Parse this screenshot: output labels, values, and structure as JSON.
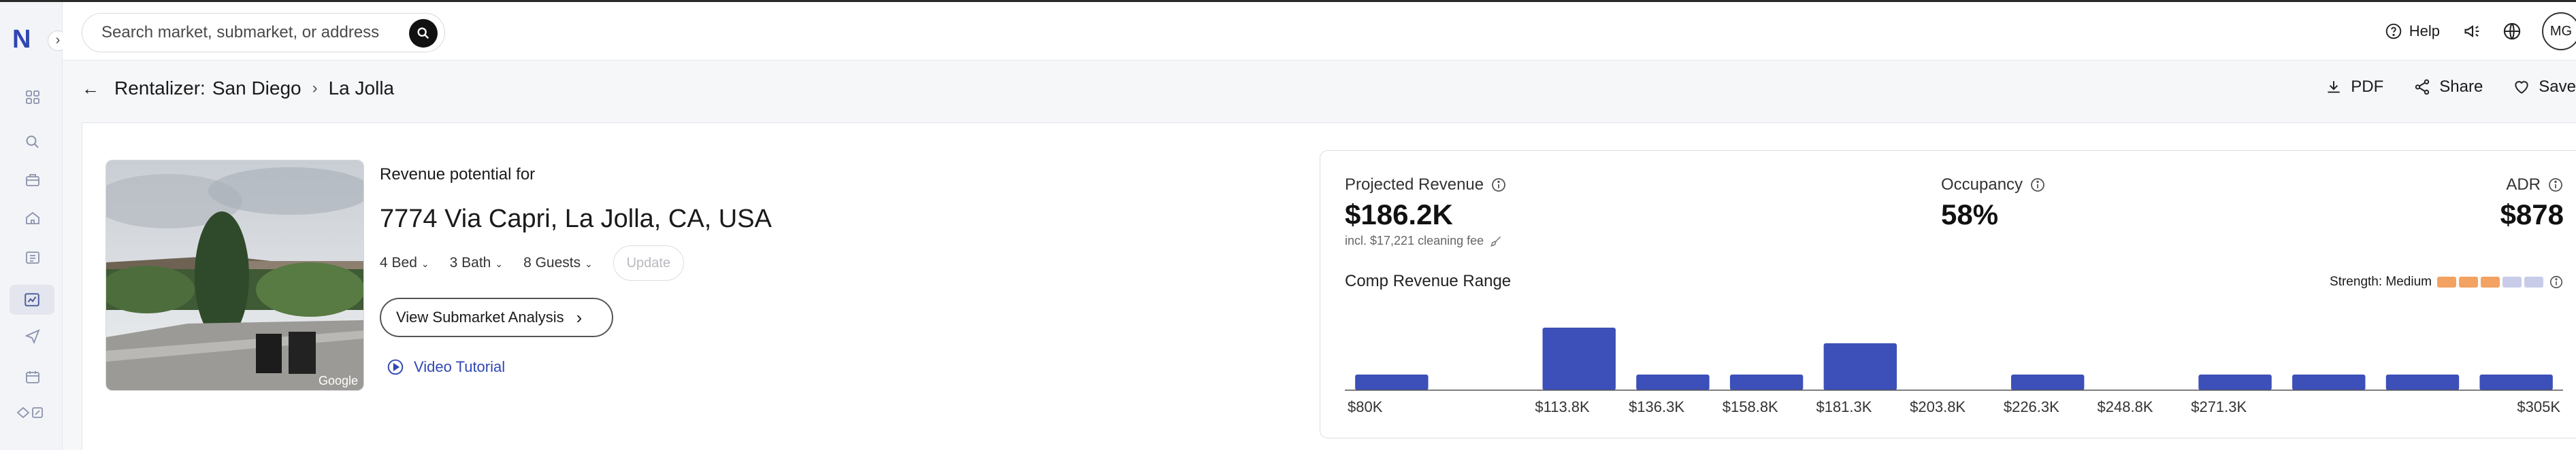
{
  "sidebar": {
    "logo": "N",
    "expand_glyph": "›",
    "icons": [
      "dashboard-icon",
      "search-icon",
      "briefcase-icon",
      "home-icon",
      "portfolio-icon",
      "rentalizer-icon",
      "send-icon",
      "calendar-icon",
      "eye-icon"
    ]
  },
  "header": {
    "search": {
      "placeholder": "Search market, submarket, or address"
    },
    "help_label": "Help",
    "avatar_initials": "MG"
  },
  "breadcrumb": {
    "tool": "Rentalizer:",
    "market": "San Diego",
    "submarket": "La Jolla"
  },
  "actions": {
    "pdf": "PDF",
    "share": "Share",
    "save": "Save"
  },
  "property": {
    "revenue_label": "Revenue potential for",
    "address": "7774 Via Capri, La Jolla, CA, USA",
    "bed": "4 Bed",
    "bath": "3 Bath",
    "guests": "8 Guests",
    "update_label": "Update",
    "submarket_button": "View Submarket Analysis",
    "video_label": "Video Tutorial",
    "photo_credit": "Google"
  },
  "metrics": {
    "projected_revenue_label": "Projected Revenue",
    "projected_revenue": "$186.2K",
    "cleaning_note": "incl. $17,221 cleaning fee",
    "occupancy_label": "Occupancy",
    "occupancy": "58%",
    "adr_label": "ADR",
    "adr": "$878"
  },
  "comp_range": {
    "label": "Comp Revenue Range",
    "strength_label": "Strength: Medium",
    "strength_level": 3,
    "strength_total": 5,
    "colors": {
      "bar": "#3d4fb8",
      "strength_on": "#f3a262",
      "strength_off": "#c8cce9"
    }
  },
  "chart_data": {
    "type": "bar",
    "title": "Comp Revenue Range",
    "tick_labels": [
      "$80K",
      "$113.8K",
      "$136.3K",
      "$158.8K",
      "$181.3K",
      "$203.8K",
      "$226.3K",
      "$248.8K",
      "$271.3K",
      "$305K"
    ],
    "bins": [
      0,
      2,
      3,
      4,
      5,
      6,
      7,
      8,
      9,
      10,
      11,
      12
    ],
    "values": [
      1,
      0,
      4,
      1,
      1,
      3,
      0,
      1,
      0,
      1,
      1,
      1,
      1
    ],
    "bin_count": 13
  }
}
